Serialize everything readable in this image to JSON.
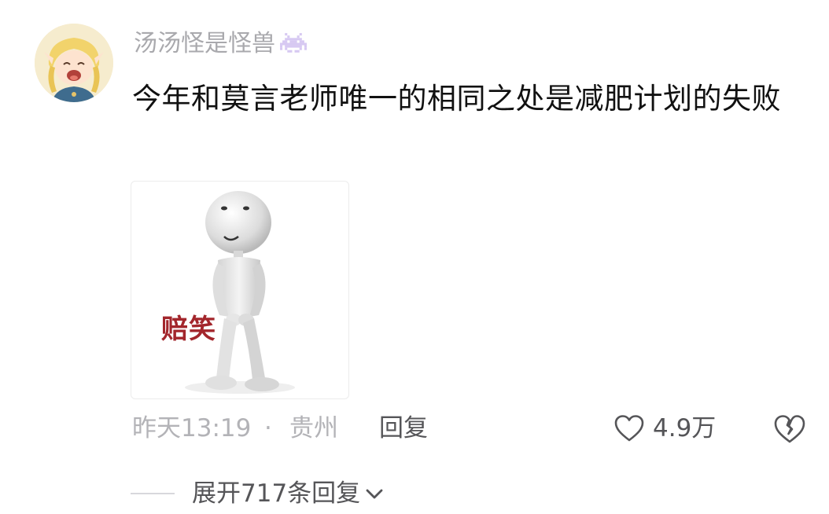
{
  "comment": {
    "username": "汤汤怪是怪兽",
    "badge_icon": "pixel-monster-icon",
    "text": "今年和莫言老师唯一的相同之处是减肥计划的失败",
    "meme_caption": "赔笑",
    "time": "昨天13:19",
    "separator": "·",
    "location": "贵州",
    "reply_label": "回复",
    "like_count": "4.9万",
    "like_icon": "heart-outline-icon",
    "dislike_icon": "broken-heart-icon"
  },
  "replies": {
    "expand_label": "展开717条回复",
    "expand_icon": "chevron-down-icon"
  },
  "colors": {
    "username": "#a9a9ad",
    "body_text": "#111111",
    "meta": "#b3b3b7",
    "action": "#555558",
    "meme_caption": "#a3262c"
  }
}
